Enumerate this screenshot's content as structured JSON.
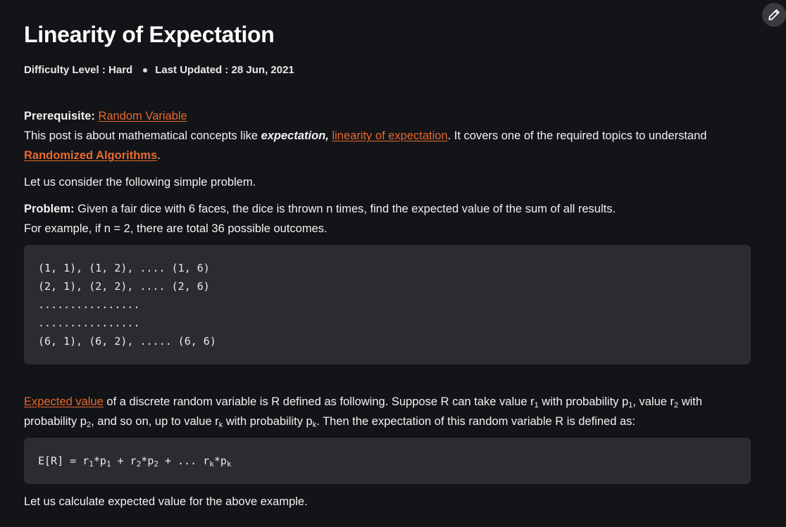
{
  "article": {
    "title": "Linearity of Expectation",
    "difficulty": "Difficulty Level : Hard",
    "updated": "Last Updated : 28 Jun, 2021"
  },
  "prereq": {
    "label": "Prerequisite:",
    "link": "Random Variable"
  },
  "intro": {
    "text1": "This post is about mathematical concepts like ",
    "italic": "expectation,",
    "link1": "linearity of expectation",
    "text2": ". It covers one of the required topics to understand",
    "link2": "Randomized Algorithms",
    "text3": "."
  },
  "consider": "Let us consider the following simple problem.",
  "problem": {
    "label": "Problem:",
    "text": "Given a fair dice with 6 faces, the dice is thrown n times, find the expected value of the sum of all results.",
    "example": "For example, if n = 2, there are total 36 possible outcomes."
  },
  "code1": {
    "lines": [
      "(1, 1), (1, 2), .... (1, 6)",
      "(2, 1), (2, 2), .... (2, 6)",
      "................",
      "................",
      "(6, 1), (6, 2), ..... (6, 6)"
    ]
  },
  "expected": {
    "link": "Expected value",
    "t1": " of a discrete random variable is R defined as following. Suppose R can take value r",
    "s1": "1",
    "t2": " with probability p",
    "s2": "1",
    "t3": ", value r",
    "s3": "2",
    "t4": " with",
    "t5": "probability p",
    "s5": "2",
    "t6": ", and so on, up to value r",
    "s6": "k",
    "t7": " with probability p",
    "s7": "k",
    "t8": ". Then the expectation of this random variable R is defined as:"
  },
  "formula": {
    "p1": "E[R] = r",
    "s1": "1",
    "p2": "*p",
    "s2": "1",
    "p3": " + r",
    "s3": "2",
    "p4": "*p",
    "s4": "2",
    "p5": " + ... r",
    "s5": "k",
    "p6": "*p",
    "s6": "k"
  },
  "calc": "Let us calculate expected value for the above example.",
  "icons": {
    "edit": "pencil-icon"
  }
}
